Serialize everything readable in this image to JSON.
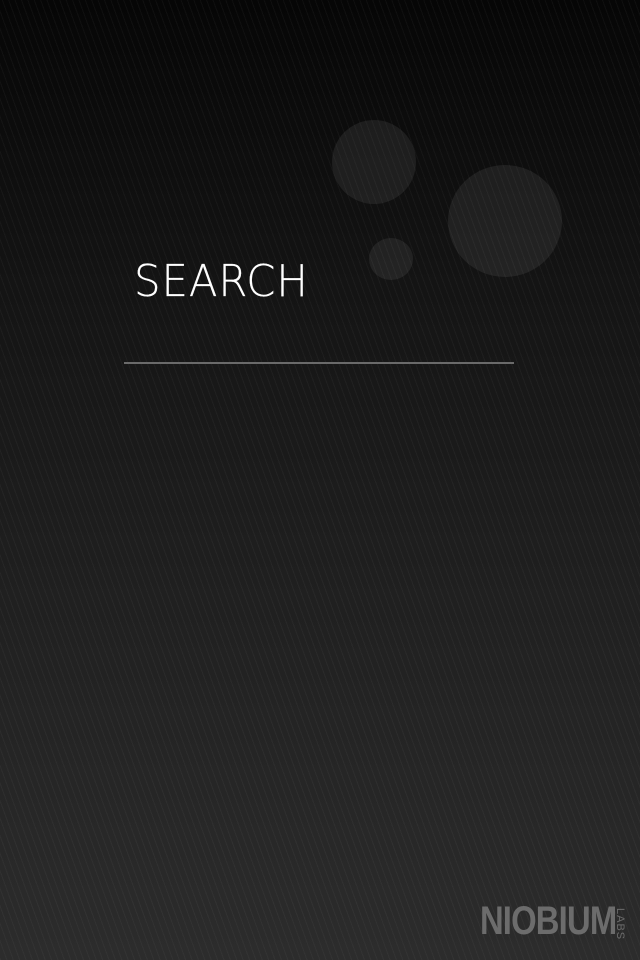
{
  "screen": {
    "title": "SEARCH"
  },
  "search": {
    "value": "",
    "placeholder": ""
  },
  "brand": {
    "name": "NIOBIUM",
    "sub": "LABS"
  }
}
